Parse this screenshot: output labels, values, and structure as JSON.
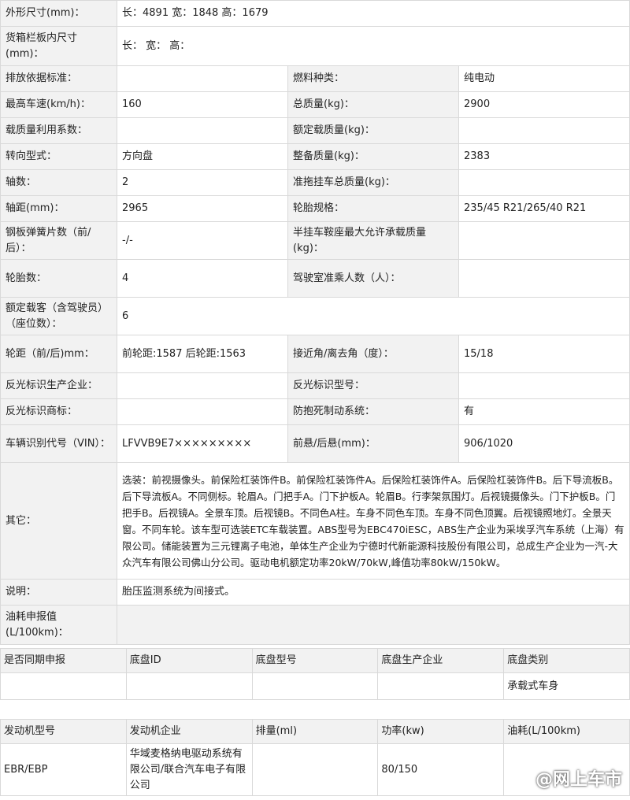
{
  "spec": {
    "dimensions_label": "外形尺寸(mm)：",
    "dimensions_value": "长：4891 宽：1848 高：1679",
    "cargo_label": "货箱栏板内尺寸(mm)：",
    "cargo_value": "长： 宽： 高：",
    "emission_label": "排放依据标准：",
    "emission_value": "",
    "fuel_label": "燃料种类：",
    "fuel_value": "纯电动",
    "maxspeed_label": "最高车速(km/h)：",
    "maxspeed_value": "160",
    "gross_label": "总质量(kg)：",
    "gross_value": "2900",
    "loadcoef_label": "载质量利用系数：",
    "loadcoef_value": "",
    "ratedload_label": "额定载质量(kg)：",
    "ratedload_value": "",
    "steering_label": "转向型式：",
    "steering_value": "方向盘",
    "curb_label": "整备质量(kg)：",
    "curb_value": "2383",
    "axles_label": "轴数：",
    "axles_value": "2",
    "trailer_label": "准拖挂车总质量(kg)：",
    "trailer_value": "",
    "wheelbase_label": "轴距(mm)：",
    "wheelbase_value": "2965",
    "tire_label": "轮胎规格：",
    "tire_value": "235/45 R21/265/40 R21",
    "spring_label": "钢板弹簧片数（前/后）：",
    "spring_value": "-/-",
    "saddle_label": "半挂车鞍座最大允许承载质量(kg)：",
    "saddle_value": "",
    "tirecount_label": "轮胎数：",
    "tirecount_value": "4",
    "cabseats_label": "驾驶室准乘人数（人）：",
    "cabseats_value": "",
    "seats_label": "额定载客（含驾驶员）（座位数）：",
    "seats_value": "6",
    "track_label": "轮距（前/后)mm：",
    "track_value": "前轮距:1587 后轮距:1563",
    "angle_label": "接近角/离去角（度）：",
    "angle_value": "15/18",
    "reflector_maker_label": "反光标识生产企业：",
    "reflector_maker_value": "",
    "reflector_model_label": "反光标识型号：",
    "reflector_model_value": "",
    "reflector_brand_label": "反光标识商标：",
    "reflector_brand_value": "",
    "abs_label": "防抱死制动系统：",
    "abs_value": "有",
    "vin_label": "车辆识别代号（VIN）：",
    "vin_value": "LFVVB9E7×××××××××",
    "overhang_label": "前悬/后悬(mm)：",
    "overhang_value": "906/1020",
    "other_label": "其它：",
    "other_value": "选装：前视摄像头。前保险杠装饰件B。前保险杠装饰件A。后保险杠装饰件A。后保险杠装饰件B。后下导流板B。后下导流板A。不同侧标。轮眉A。门把手A。门下护板A。轮眉B。行李架氛围灯。后视镜摄像头。门下护板B。门把手B。后视镜A。全景车顶。后视镜B。不同色A柱。车身不同色车顶。车身不同色顶翼。后视镜照地灯。全景天窗。不同车轮。该车型可选装ETC车载装置。ABS型号为EBC470iESC，ABS生产企业为采埃孚汽车系统（上海）有限公司。储能装置为三元锂离子电池，单体生产企业为宁德时代新能源科技股份有限公司，总成生产企业为一汽-大众汽车有限公司佛山分公司。驱动电机额定功率20kW/70kW,峰值功率80kW/150kW。",
    "note_label": "说明：",
    "note_value": "胎压监测系统为间接式。",
    "consumption_label": "油耗申报值(L/100km)：",
    "consumption_value": ""
  },
  "chassis": {
    "headers": [
      "是否同期申报",
      "底盘ID",
      "底盘型号",
      "底盘生产企业",
      "底盘类别"
    ],
    "row": [
      "",
      "",
      "",
      "",
      "承载式车身"
    ]
  },
  "engine": {
    "headers": [
      "发动机型号",
      "发动机企业",
      "排量(ml)",
      "功率(kw)",
      "油耗(L/100km)"
    ],
    "row": [
      "EBR/EBP",
      "华域麦格纳电驱动系统有限公司/联合汽车电子有限公司",
      "",
      "80/150",
      ""
    ]
  },
  "watermark": "@网上车市"
}
